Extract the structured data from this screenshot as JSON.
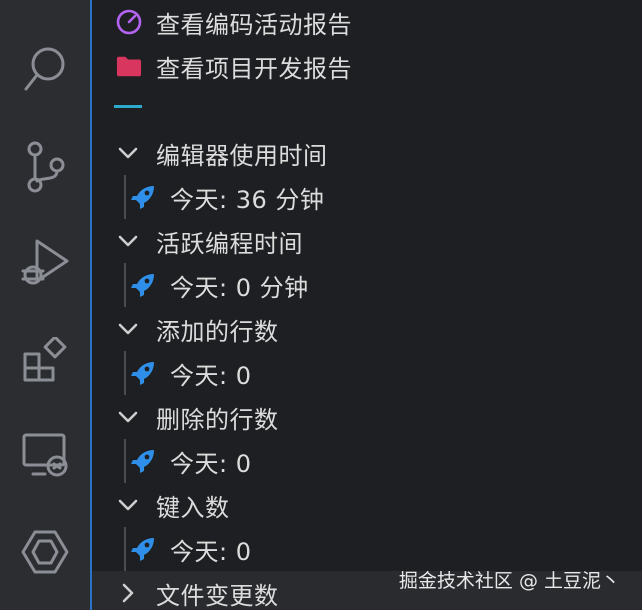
{
  "top_links": [
    {
      "label": "查看编码活动报告",
      "icon": "dashboard-gauge-icon",
      "color": "#b464f2"
    },
    {
      "label": "查看项目开发报告",
      "icon": "folder-icon",
      "color": "#d8365f"
    }
  ],
  "sections": [
    {
      "title": "编辑器使用时间",
      "item": "今天: 36 分钟"
    },
    {
      "title": "活跃编程时间",
      "item": "今天: 0 分钟"
    },
    {
      "title": "添加的行数",
      "item": "今天: 0"
    },
    {
      "title": "删除的行数",
      "item": "今天: 0"
    },
    {
      "title": "键入数",
      "item": "今天: 0"
    }
  ],
  "collapsed_section": {
    "title": "文件变更数"
  },
  "watermark": "掘金技术社区 @ 土豆泥丶",
  "colors": {
    "accent": "#2b73c5",
    "rocket": "#2f8fe8"
  }
}
